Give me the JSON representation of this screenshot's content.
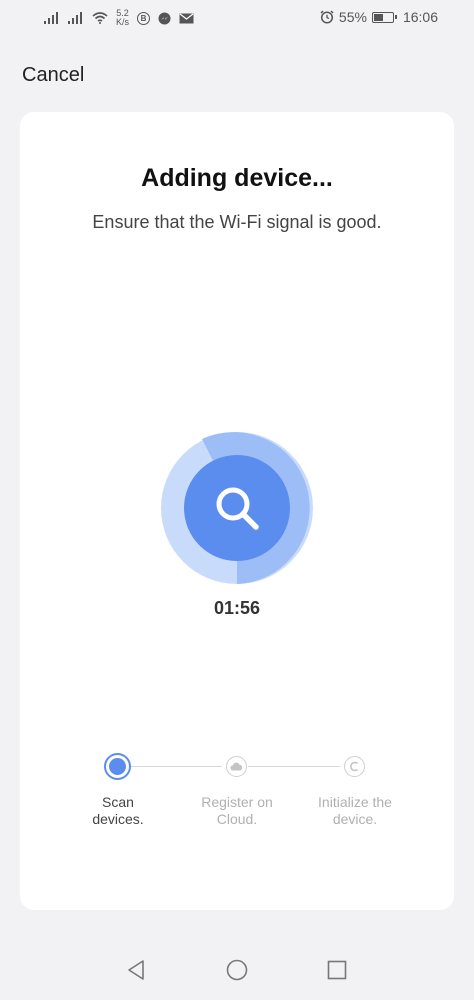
{
  "status_bar": {
    "net_speed_value": "5.2",
    "net_speed_unit": "K/s",
    "bluetooth_badge": "B",
    "battery_percent": "55%",
    "time": "16:06",
    "battery_level": 0.55
  },
  "header": {
    "cancel_label": "Cancel"
  },
  "card": {
    "title": "Adding device...",
    "subtitle": "Ensure that the Wi-Fi signal is good.",
    "timer": "01:56"
  },
  "steps": [
    {
      "line1": "Scan",
      "line2": "devices.",
      "state": "active"
    },
    {
      "line1": "Register on",
      "line2": "Cloud.",
      "state": "pending"
    },
    {
      "line1": "Initialize the",
      "line2": "device.",
      "state": "pending"
    }
  ],
  "colors": {
    "accent": "#5b8def",
    "ring": "#c9dbfa",
    "ring_progress": "#9dbdf6",
    "inactive_text": "#b0b0b0",
    "active_text": "#444444"
  }
}
